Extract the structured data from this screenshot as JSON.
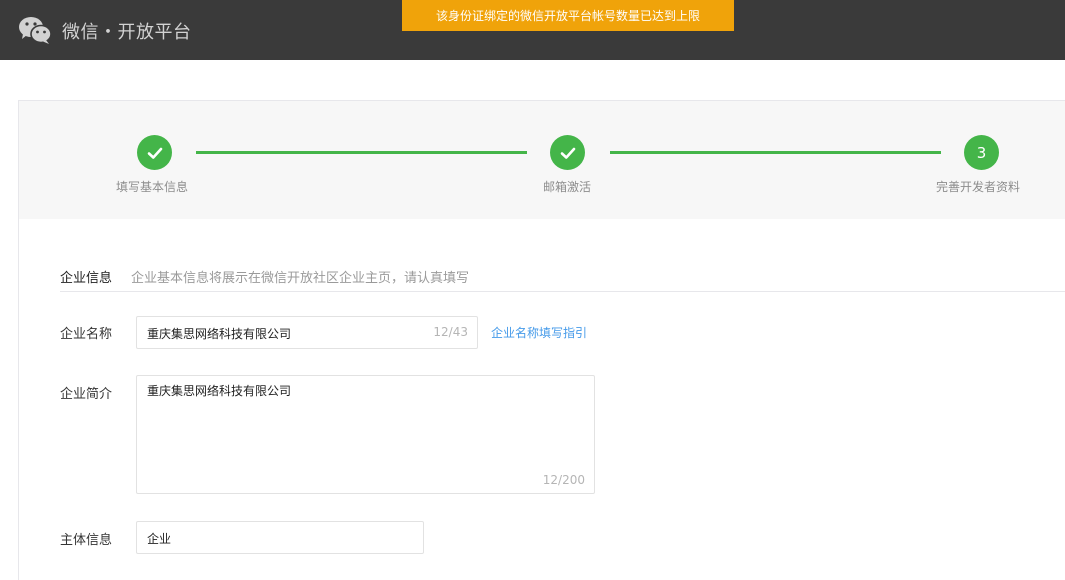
{
  "header": {
    "brand": "微信・开放平台",
    "alert": "该身份证绑定的微信开放平台帐号数量已达到上限"
  },
  "steps": {
    "step1": {
      "label": "填写基本信息",
      "state": "done"
    },
    "step2": {
      "label": "邮箱激活",
      "state": "done"
    },
    "step3": {
      "label": "完善开发者资料",
      "number": "3",
      "state": "current"
    }
  },
  "section": {
    "title": "企业信息",
    "description": "企业基本信息将展示在微信开放社区企业主页，请认真填写"
  },
  "form": {
    "company_name": {
      "label": "企业名称",
      "value": "重庆集思网络科技有限公司",
      "counter": "12/43",
      "guide_link": "企业名称填写指引"
    },
    "company_intro": {
      "label": "企业简介",
      "value": "重庆集思网络科技有限公司",
      "counter": "12/200"
    },
    "entity_info": {
      "label": "主体信息",
      "value": "企业"
    }
  },
  "colors": {
    "topbar": "#3a3a3a",
    "alert": "#f0a30a",
    "step_green": "#44b549",
    "link_blue": "#459ae9"
  }
}
